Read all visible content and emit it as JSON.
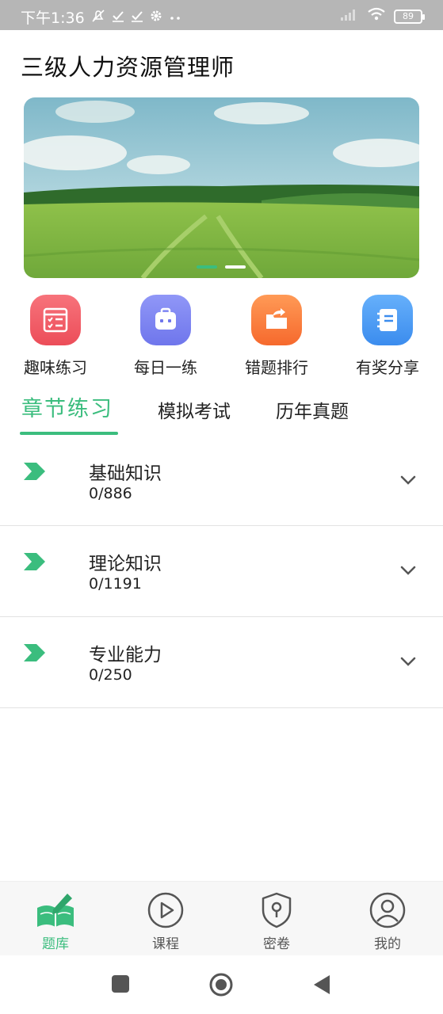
{
  "status_bar": {
    "time": "下午1:36",
    "battery": "89",
    "icons": [
      "mute-icon",
      "check-icon",
      "check-icon",
      "gear-icon",
      "more-dots-icon",
      "signal-icon",
      "wifi-icon",
      "battery-icon"
    ]
  },
  "header": {
    "title": "三级人力资源管理师"
  },
  "banner": {
    "slides": 2,
    "active_index": 0
  },
  "quick_entries": [
    {
      "label": "趣味练习",
      "icon": "checklist-icon",
      "color": "#f25a64"
    },
    {
      "label": "每日一练",
      "icon": "calendar-box-icon",
      "color": "#7b82f2"
    },
    {
      "label": "错题排行",
      "icon": "folder-arrow-icon",
      "color": "#fb7a3c"
    },
    {
      "label": "有奖分享",
      "icon": "notebook-icon",
      "color": "#4d9cf5"
    }
  ],
  "tabs": [
    {
      "label": "章节练习",
      "active": true
    },
    {
      "label": "模拟考试",
      "active": false
    },
    {
      "label": "历年真题",
      "active": false
    }
  ],
  "chapters": [
    {
      "name": "基础知识",
      "progress": "0/886"
    },
    {
      "name": "理论知识",
      "progress": "0/1191"
    },
    {
      "name": "专业能力",
      "progress": "0/250"
    }
  ],
  "bottom_nav": [
    {
      "label": "题库",
      "icon": "book-pen-icon",
      "active": true
    },
    {
      "label": "课程",
      "icon": "play-circle-icon",
      "active": false
    },
    {
      "label": "密卷",
      "icon": "shield-lock-icon",
      "active": false
    },
    {
      "label": "我的",
      "icon": "user-circle-icon",
      "active": false
    }
  ],
  "colors": {
    "accent": "#3bbd7e",
    "status_bar": "#b6b6b6"
  }
}
